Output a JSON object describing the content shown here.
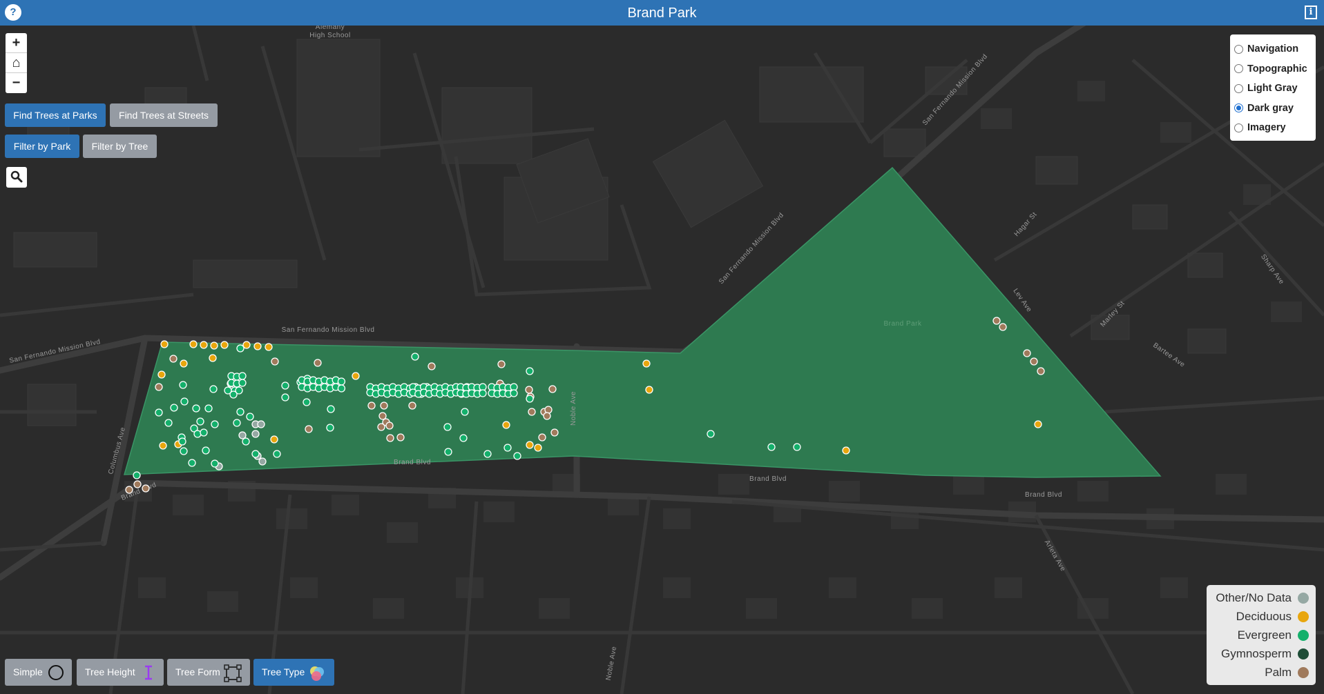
{
  "app": {
    "title": "Brand Park",
    "help_label": "?",
    "info_label": "i"
  },
  "zoom": {
    "in_label": "+",
    "home_label": "⌂",
    "out_label": "−"
  },
  "search_mode": {
    "parks_label": "Find Trees at Parks",
    "streets_label": "Find Trees at Streets"
  },
  "filter_mode": {
    "park_label": "Filter by Park",
    "tree_label": "Filter by Tree"
  },
  "basemap": {
    "options": [
      "Navigation",
      "Topographic",
      "Light Gray",
      "Dark gray",
      "Imagery"
    ],
    "selected": "Dark gray"
  },
  "legend": {
    "items": [
      {
        "label": "Other/No Data",
        "color": "#95a8a3"
      },
      {
        "label": "Deciduous",
        "color": "#e8a60e"
      },
      {
        "label": "Evergreen",
        "color": "#14b06b"
      },
      {
        "label": "Gymnosperm",
        "color": "#1f4d37"
      },
      {
        "label": "Palm",
        "color": "#a07a5c"
      }
    ]
  },
  "view_modes": {
    "simple_label": "Simple",
    "height_label": "Tree Height",
    "form_label": "Tree Form",
    "type_label": "Tree Type",
    "active": "Tree Type"
  },
  "map_labels": {
    "alemany_1": "Alemany",
    "alemany_2": "High School",
    "sfm_top": "San Fernando Mission Blvd",
    "sfm_left": "San Fernando Mission Blvd",
    "sfm_mid": "San Fernando Mission Blvd",
    "sfm_right": "San Fernando Mission Blvd",
    "brand_park": "Brand Park",
    "brand_1": "Brand Blvd",
    "brand_2": "Brand Blvd",
    "brand_3": "Brand Blvd",
    "brand_left": "Brand Blvd",
    "columbus": "Columbus Ave",
    "noble_top": "Noble Ave",
    "noble_bottom": "Noble Ave",
    "hagar": "Hagar St",
    "sharp": "Sharp Ave",
    "lev": "Lev Ave",
    "marley": "Marley St",
    "bartee": "Bartee Ave",
    "arleta": "Arleta Ave"
  },
  "colors": {
    "header": "#2e73b5",
    "park": "#2e7a50",
    "map_bg": "#2b2b2b",
    "road": "#3b3b3b"
  }
}
